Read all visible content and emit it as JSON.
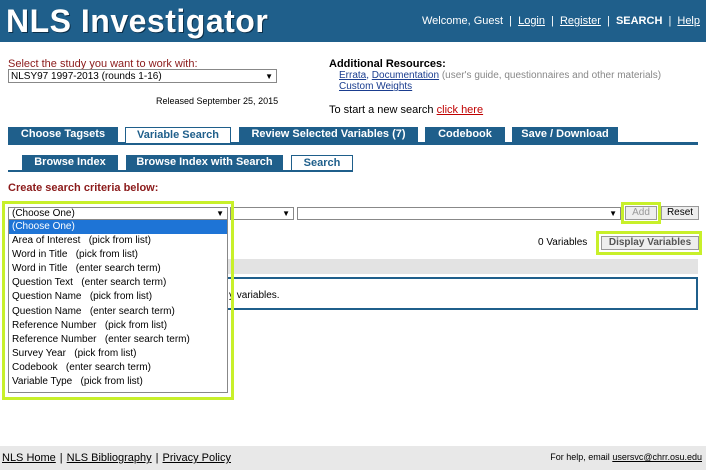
{
  "header": {
    "logo": "NLS Investigator",
    "welcome": "Welcome, Guest",
    "nav": [
      "Login",
      "Register",
      "SEARCH",
      "Help"
    ]
  },
  "study": {
    "label": "Select the study you want to work with:",
    "selected": "NLSY97 1997-2013 (rounds 1-16)",
    "released": "Released September 25, 2015"
  },
  "resources": {
    "title": "Additional Resources:",
    "errata": "Errata",
    "documentation": "Documentation",
    "doc_note": "(user's guide, questionnaires and other materials)",
    "custom_weights": "Custom Weights",
    "new_search_prefix": "To start a new search",
    "new_search_link": "click here"
  },
  "main_tabs": [
    "Choose Tagsets",
    "Variable Search",
    "Review Selected Variables (7)",
    "Codebook",
    "Save / Download"
  ],
  "sub_tabs": [
    "Browse Index",
    "Browse Index with Search",
    "Search"
  ],
  "criteria": {
    "label": "Create search criteria below:",
    "choose_value": "(Choose One)",
    "add": "Add",
    "reset": "Reset",
    "var_count": "0 Variables",
    "display": "Display Variables",
    "result_text": "y variables."
  },
  "dropdown_options": [
    "(Choose One)",
    "Area of Interest   (pick from list)",
    "Word in Title   (pick from list)",
    "Word in Title   (enter search term)",
    "Question Text   (enter search term)",
    "Question Name   (pick from list)",
    "Question Name   (enter search term)",
    "Reference Number   (pick from list)",
    "Reference Number   (enter search term)",
    "Survey Year   (pick from list)",
    "Codebook   (enter search term)",
    "Variable Type   (pick from list)"
  ],
  "footer": {
    "links": [
      "NLS Home",
      "NLS Bibliography",
      "Privacy Policy"
    ],
    "help_prefix": "For help, email",
    "help_email": "usersvc@chrr.osu.edu"
  },
  "colors": {
    "brand": "#1f5f8b",
    "highlight": "#c8f02a",
    "selected_option": "#1e74d6",
    "label_red": "#8b1a1a"
  }
}
